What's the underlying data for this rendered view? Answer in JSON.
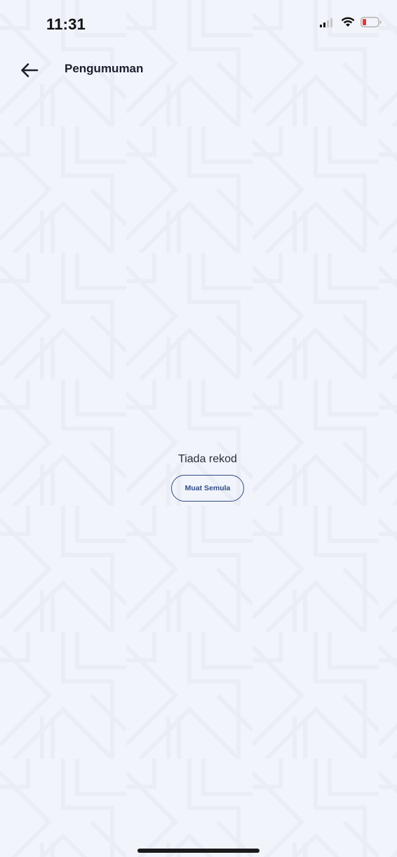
{
  "status_bar": {
    "time": "11:31"
  },
  "header": {
    "title": "Pengumuman",
    "back_icon": "arrow-left-icon"
  },
  "empty_state": {
    "message": "Tiada rekod",
    "reload_label": "Muat Semula"
  },
  "colors": {
    "background": "#f2f4fb",
    "accent": "#2f4d86",
    "battery_low": "#e53935"
  }
}
